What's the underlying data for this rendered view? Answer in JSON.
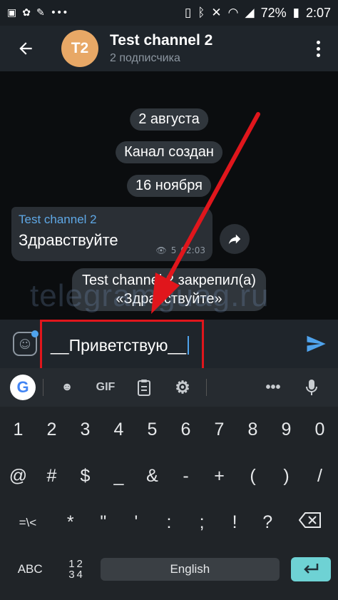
{
  "status_bar": {
    "battery": "72%",
    "time": "2:07",
    "left_icons": [
      "image-icon",
      "settings-icon",
      "broom-icon",
      "more-icon"
    ],
    "right_icons": [
      "sim-icon",
      "bluetooth-icon",
      "mute-icon",
      "wifi-icon",
      "signal-icon",
      "battery-icon"
    ]
  },
  "header": {
    "avatar_initials": "T2",
    "title": "Test channel 2",
    "subtitle": "2 подписчика"
  },
  "chat": {
    "date_1": "2 августа",
    "service_created": "Канал создан",
    "date_2": "16 ноября",
    "message": {
      "author": "Test channel 2",
      "text": "Здравствуйте",
      "views": "5",
      "time": "02:03"
    },
    "pinned_line_1": "Test channel 2 закрепил(а)",
    "pinned_line_2": "«Здравствуйте»",
    "watermark": "telegramguag.ru"
  },
  "composer": {
    "value": "__Приветствую__"
  },
  "keyboard": {
    "toolbar": [
      "G",
      "GIF"
    ],
    "row1": [
      "1",
      "2",
      "3",
      "4",
      "5",
      "6",
      "7",
      "8",
      "9",
      "0"
    ],
    "row2": [
      "@",
      "#",
      "$",
      "_",
      "&",
      "-",
      "+",
      "(",
      ")",
      "/"
    ],
    "row3": [
      "=\\<",
      "*",
      "\"",
      "'",
      ":",
      ";",
      "!",
      "?"
    ],
    "bottom": {
      "abc": "ABC",
      "num_top": "12",
      "num_bottom": "34",
      "space": "English"
    }
  },
  "colors": {
    "accent": "#4fa3ec",
    "annotation_red": "#e0161c",
    "enter_key": "#6ed2d4",
    "avatar": "#e8a866"
  }
}
